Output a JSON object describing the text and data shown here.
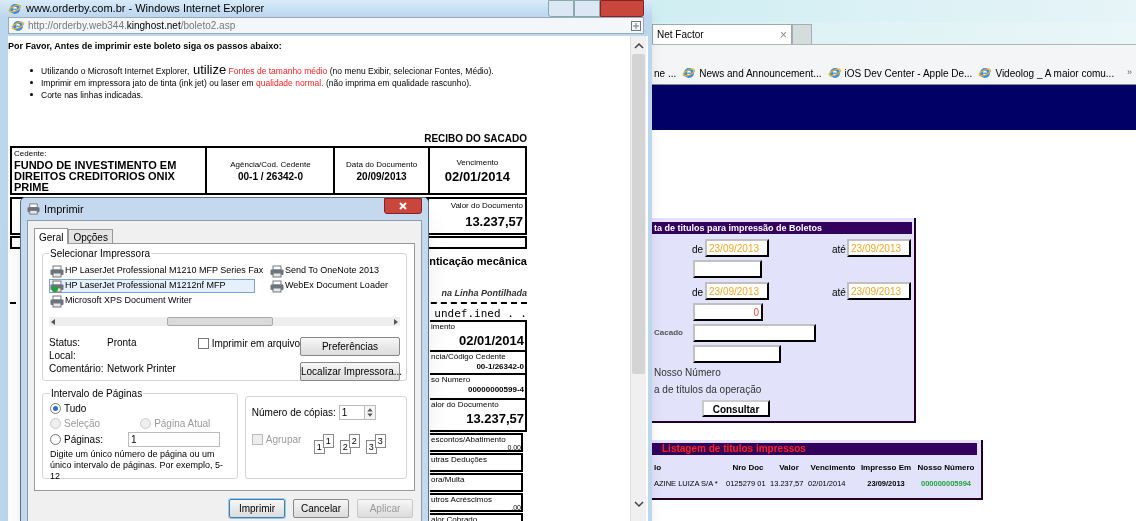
{
  "background_browser": {
    "tab": {
      "title": "Net Factor",
      "close": "×"
    },
    "favorites": [
      {
        "label": "ne ...",
        "icon": false
      },
      {
        "label": "News and Announcement...",
        "icon": true
      },
      {
        "label": "iOS Dev Center - Apple De...",
        "icon": true
      },
      {
        "label": "Videolog _ A maior comu...",
        "icon": true
      }
    ],
    "more": "»",
    "query_panel": {
      "title": "ta de titulos para impressão de Boletos",
      "rows": [
        {
          "kind": "range",
          "from_label": "de",
          "from": "23/09/2013",
          "to_label": "até",
          "to": "23/09/2013"
        },
        {
          "kind": "blank"
        },
        {
          "kind": "range",
          "from_label": "de",
          "from": "23/09/2013",
          "to_label": "até",
          "to": "23/09/2013"
        },
        {
          "kind": "number",
          "value": "0"
        },
        {
          "kind": "labeled",
          "label": "Cacado"
        },
        {
          "kind": "blank"
        },
        {
          "kind": "option",
          "text": "Nosso Número"
        },
        {
          "kind": "option",
          "text": "a de títulos da operação"
        }
      ],
      "button": "Consultar"
    },
    "list_panel": {
      "title": "Listagem de titulos impressos",
      "columns": [
        "lo",
        "Nro Doc",
        "Valor",
        "Vencimento",
        "Impresso Em",
        "Nosso Número"
      ],
      "rows": [
        {
          "cells": [
            "AZINE LUIZA S/A *",
            "0125279 01",
            "13.237,57",
            "02/01/2014",
            "23/09/2013",
            "000000005994"
          ]
        }
      ]
    }
  },
  "popup": {
    "title": "www.orderby.com.br - Windows Internet Explorer",
    "url": {
      "prefix": "http://orderby.web344.",
      "host": "kinghost.net",
      "path": "/boleto2.asp"
    },
    "heading": "Por Favor, Antes de imprimir este boleto siga os passos abaixo:",
    "bullets": [
      {
        "lead": "Utilizando o Microsoft Internet Explorer,",
        "keyword": "utilize",
        "highlight": "Fontes de tamanho médio",
        "tail": "(no menu Exibir, selecionar Fontes, Médio)."
      },
      {
        "lead": "Imprimir em impressora jato de tinta (ink jet) ou laser em",
        "highlight": "qualidade normal.",
        "tail": "(não imprima em qualidade rascunho)."
      },
      {
        "lead": "Corte nas linhas indicadas."
      }
    ],
    "receipt": {
      "title": "RECIBO DO SACADO",
      "header_cells": [
        {
          "label": "Cedente:",
          "value": "FUNDO DE INVESTIMENTO EM DIREITOS CREDITORIOS ONIX PRIME"
        },
        {
          "label": "Agência/Cod. Cedente",
          "value": "00-1 / 26342-0"
        },
        {
          "label": "Data do Documento",
          "value": "20/09/2013"
        },
        {
          "label": "Vencimento",
          "value": "02/01/2014"
        }
      ],
      "amount": {
        "label": "Valor do Documento",
        "value": "13.237,57"
      },
      "auth_caption": "nticação mecânica",
      "cut_caption": "na Linha Pontilhada",
      "line_code": "undef.ined . .",
      "side_cells": [
        {
          "label": "imento",
          "value": "02/01/2014"
        },
        {
          "label": "ncia/Código Cedente",
          "value": "00-1/26342-0"
        },
        {
          "label": "so Numero",
          "value": "00000000599-4"
        },
        {
          "label": "alor do Documento",
          "value": "13.237,57"
        }
      ],
      "inner_cells": [
        {
          "label": "escontos/Abatimento",
          "value": "0,00"
        },
        {
          "label": "utras Deduções"
        },
        {
          "label": "ora/Multa"
        },
        {
          "label": "utros Acréscimos",
          "value": ",00"
        },
        {
          "label": "alor Cobrado"
        }
      ]
    }
  },
  "print_dialog": {
    "title": "Imprimir",
    "tabs": [
      {
        "label": "Geral",
        "selected": true
      },
      {
        "label": "Opções",
        "selected": false
      }
    ],
    "printer_group": "Selecionar Impressora",
    "printers": [
      {
        "name": "HP LaserJet Professional M1210 MFP Series Fax",
        "selected": false,
        "default": false
      },
      {
        "name": "Send To OneNote 2013",
        "selected": false,
        "default": false
      },
      {
        "name": "HP LaserJet Professional M1212nf MFP",
        "selected": true,
        "default": true
      },
      {
        "name": "WebEx Document Loader",
        "selected": false,
        "default": false
      },
      {
        "name": "Microsoft XPS Document Writer",
        "selected": false,
        "default": false
      }
    ],
    "info": [
      {
        "label": "Status:",
        "value": "Pronta"
      },
      {
        "label": "Local:"
      },
      {
        "label": "Comentário:",
        "value": "Network Printer"
      }
    ],
    "print_to_file": {
      "label": "Imprimir em arquivo",
      "checked": false
    },
    "preferences_button": "Preferências",
    "find_button": "Localizar Impressora...",
    "range_group": "Intervalo de Páginas",
    "ranges": [
      {
        "label": "Tudo",
        "selected": true,
        "disabled": false
      },
      {
        "label": "Seleção",
        "selected": false,
        "disabled": true
      },
      {
        "label": "Página Atual",
        "selected": false,
        "disabled": true
      },
      {
        "label": "Páginas:",
        "selected": false,
        "disabled": false
      }
    ],
    "pages_value": "1",
    "range_hint": "Digite um único número de página ou um único intervalo de páginas. Por exemplo, 5-12",
    "copies_label": "Número de cópias:",
    "copies": "1",
    "collate": {
      "label": "Agrupar",
      "checked": false,
      "disabled": true
    },
    "collate_pages": [
      "1",
      "1",
      "2",
      "2",
      "3",
      "3"
    ],
    "buttons": [
      {
        "label": "Imprimir",
        "default": true,
        "disabled": false
      },
      {
        "label": "Cancelar",
        "default": false,
        "disabled": false
      },
      {
        "label": "Aplicar",
        "default": false,
        "disabled": true
      }
    ]
  }
}
